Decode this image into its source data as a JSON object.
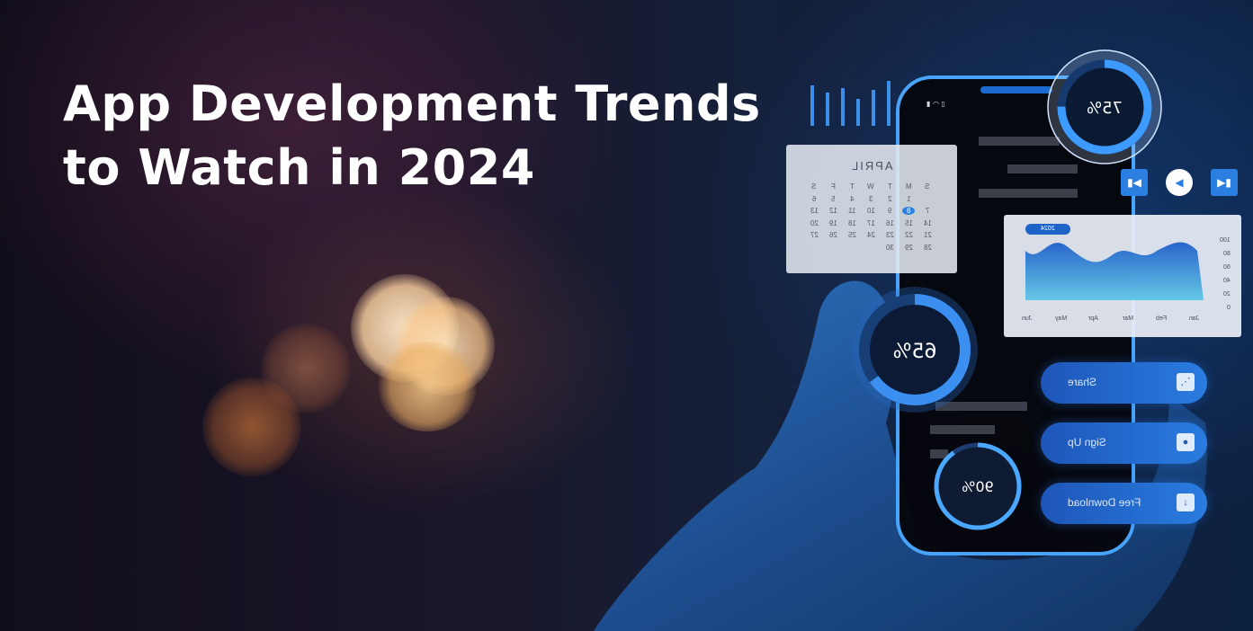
{
  "headline": {
    "line1": "App Development Trends",
    "line2": "to Watch in 2024"
  },
  "calendar": {
    "month": "APRIL",
    "weekdays": [
      "S",
      "M",
      "T",
      "W",
      "T",
      "F",
      "S"
    ],
    "days": [
      "1",
      "2",
      "3",
      "4",
      "5",
      "6",
      "7",
      "8",
      "9",
      "10",
      "11",
      "12",
      "13",
      "14",
      "15",
      "16",
      "17",
      "18",
      "19",
      "20",
      "21",
      "22",
      "23",
      "24",
      "25",
      "26",
      "27",
      "28",
      "29",
      "30"
    ],
    "highlighted_day": "8"
  },
  "gauges": {
    "top": "75%",
    "middle": "65%",
    "bottom": "90%"
  },
  "gauge_levels": {
    "top": 0.75,
    "middle": 0.65,
    "bottom": 0.9
  },
  "area_chart": {
    "year_badge": "2024",
    "y_ticks": [
      "100",
      "80",
      "60",
      "40",
      "20",
      "0"
    ],
    "months": [
      "Jan",
      "Feb",
      "Mar",
      "Apr",
      "May",
      "Jun"
    ]
  },
  "buttons": {
    "share": "Share",
    "sign_up": "Sign Up",
    "free_download": "Free Download"
  },
  "icons": {
    "share": "share-icon",
    "sign_up": "user-icon",
    "free_download": "download-icon"
  },
  "colors": {
    "accent_blue": "#2a7fe0",
    "glow_cyan": "#4aa8ff",
    "headline": "#ffffff"
  }
}
